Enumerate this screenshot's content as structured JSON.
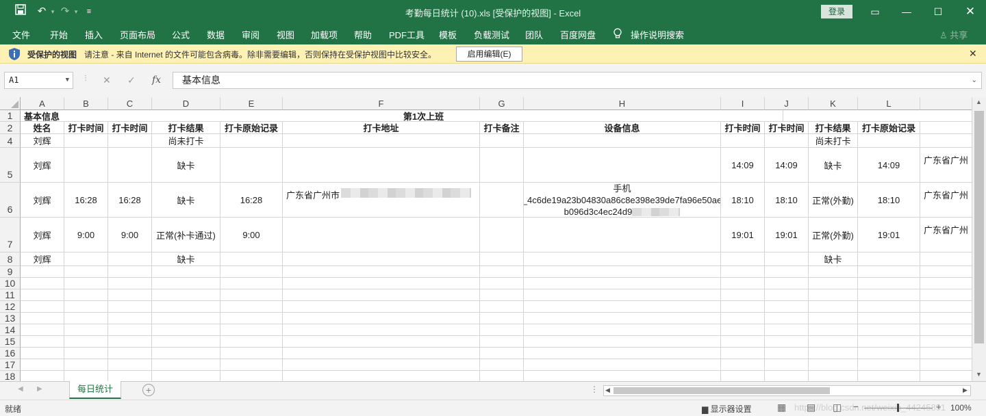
{
  "window": {
    "title": "考勤每日统计 (10).xls  [受保护的视图]  -  Excel",
    "login": "登录",
    "icons": [
      "save-icon",
      "undo-icon",
      "redo-icon",
      "customize-qat-icon",
      "ribbon-display-icon",
      "minimize-icon",
      "maximize-icon",
      "close-icon"
    ]
  },
  "ribbon": {
    "tabs": [
      "文件",
      "开始",
      "插入",
      "页面布局",
      "公式",
      "数据",
      "审阅",
      "视图",
      "加载项",
      "帮助",
      "PDF工具",
      "模板",
      "负载测试",
      "团队",
      "百度网盘",
      "操作说明搜索"
    ],
    "share": "共享"
  },
  "protected": {
    "title": "受保护的视图",
    "message": "请注意 - 来自 Internet 的文件可能包含病毒。除非需要编辑，否则保持在受保护视图中比较安全。",
    "enable_button": "启用编辑(E)"
  },
  "formula_bar": {
    "namebox": "A1",
    "fx": "fx",
    "content": "基本信息"
  },
  "columns": [
    "A",
    "B",
    "C",
    "D",
    "E",
    "F",
    "G",
    "H",
    "I",
    "J",
    "K",
    "L"
  ],
  "rows": [
    "1",
    "2",
    "4",
    "5",
    "6",
    "7",
    "8",
    "9",
    "10",
    "11",
    "12",
    "13",
    "14",
    "15",
    "16",
    "17",
    "18"
  ],
  "cells": {
    "r1_basic": "基本信息",
    "r1_first_shift": "第1次上班",
    "headers": [
      "姓名",
      "打卡时间",
      "打卡时间",
      "打卡结果",
      "打卡原始记录",
      "打卡地址",
      "打卡备注",
      "设备信息",
      "打卡时间",
      "打卡时间",
      "打卡结果",
      "打卡原始记录"
    ],
    "name": "刘辉",
    "r4_D": "尚未打卡",
    "r4_K": "尚未打卡",
    "r5_D": "缺卡",
    "r5_I": "14:09",
    "r5_J": "14:09",
    "r5_K": "缺卡",
    "r5_L": "14:09",
    "r5_M": "广东省广州",
    "r6_B": "16:28",
    "r6_C": "16:28",
    "r6_D": "缺卡",
    "r6_E": "16:28",
    "r6_F": "广东省广州市",
    "r6_H1": "手机",
    "r6_H2": "_4c6de19a23b04830a86c8e398e39de7fa96e50ae",
    "r6_H3": "b096d3c4ec24d9",
    "r6_I": "18:10",
    "r6_J": "18:10",
    "r6_K": "正常(外勤)",
    "r6_L": "18:10",
    "r6_M": "广东省广州",
    "r7_B": "9:00",
    "r7_C": "9:00",
    "r7_D": "正常(补卡通过)",
    "r7_E": "9:00",
    "r7_I": "19:01",
    "r7_J": "19:01",
    "r7_K": "正常(外勤)",
    "r7_L": "19:01",
    "r7_M": "广东省广州",
    "r8_D": "缺卡",
    "r8_K": "缺卡"
  },
  "sheet_tabs": [
    "每日统计"
  ],
  "status": {
    "ready": "就绪",
    "display_settings": "显示器设置",
    "watermark": "https://blog.csdn.net/weixin_44245891",
    "zoom": "100%"
  }
}
